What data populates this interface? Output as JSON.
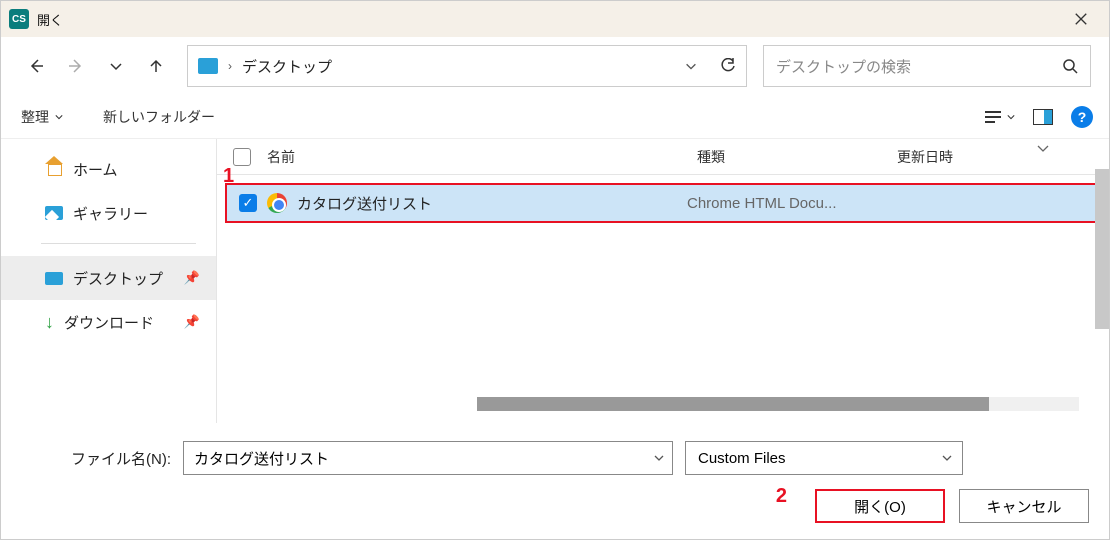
{
  "titlebar": {
    "app_badge": "CS",
    "title": "開く"
  },
  "nav": {
    "path": "デスクトップ",
    "search_placeholder": "デスクトップの検索"
  },
  "toolbar": {
    "organize": "整理",
    "new_folder": "新しいフォルダー"
  },
  "sidebar": {
    "items": [
      {
        "label": "ホーム"
      },
      {
        "label": "ギャラリー"
      },
      {
        "label": "デスクトップ"
      },
      {
        "label": "ダウンロード"
      }
    ]
  },
  "list": {
    "headers": {
      "name": "名前",
      "type": "種類",
      "date": "更新日時"
    },
    "rows": [
      {
        "name": "カタログ送付リスト",
        "type": "Chrome HTML Docu...",
        "date": ""
      }
    ]
  },
  "bottom": {
    "file_label": "ファイル名(N):",
    "filename": "カタログ送付リスト",
    "filter": "Custom Files",
    "open": "開く(O)",
    "cancel": "キャンセル"
  },
  "annotations": {
    "one": "1",
    "two": "2"
  }
}
